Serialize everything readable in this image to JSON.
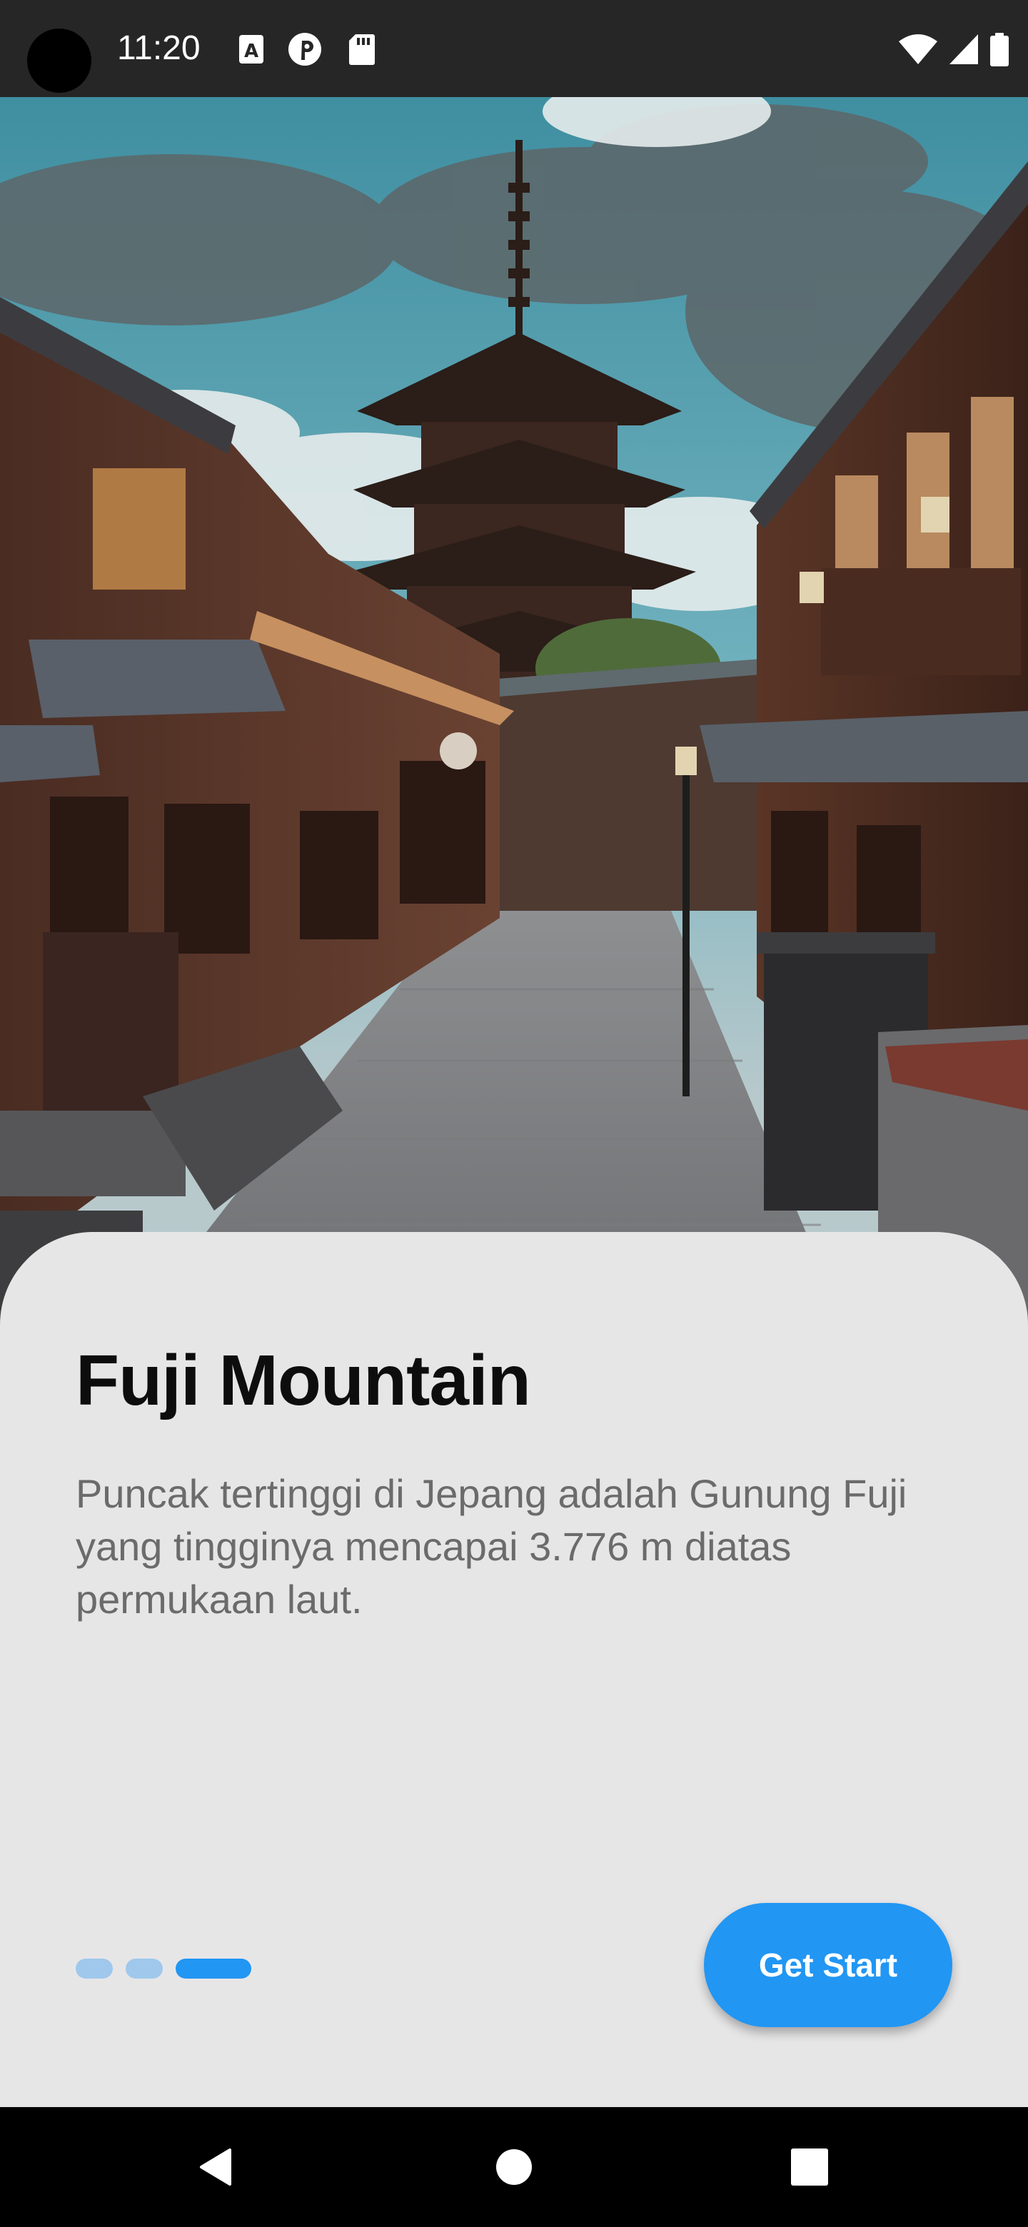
{
  "status_bar": {
    "time": "11:20",
    "notification_icons": [
      "font-a-icon",
      "pinterest-like-icon",
      "sd-card-icon"
    ],
    "system_icons": [
      "wifi-icon",
      "cell-signal-icon",
      "battery-icon"
    ]
  },
  "hero": {
    "image": "kyoto-street-pagoda-photo"
  },
  "onboarding": {
    "title": "Fuji Mountain",
    "description": "Puncak tertinggi di Jepang adalah Gunung Fuji yang tingginya mencapai 3.776 m diatas permukaan laut.",
    "page_indicator": {
      "total": 3,
      "active_index": 2
    },
    "cta_label": "Get Start"
  },
  "nav_bar": {
    "buttons": [
      "back-icon",
      "home-icon",
      "recents-icon"
    ]
  },
  "colors": {
    "accent": "#2196F3",
    "dot_inactive": "#9FC8EC",
    "card_background": "#E7E6E7",
    "title_text": "#0D0D0D",
    "description_text": "#6B6B6B",
    "status_bar": "#262626",
    "nav_bar": "#000000"
  }
}
